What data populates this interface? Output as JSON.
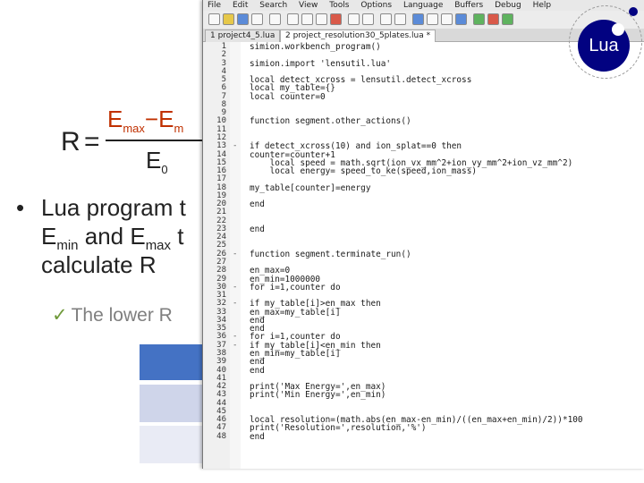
{
  "slide": {
    "formula": {
      "lhs": "R",
      "equals": "=",
      "numerator_a": "E",
      "numerator_a_sub": "max",
      "minus": "−",
      "numerator_b": "E",
      "numerator_b_sub": "m",
      "denominator": "E",
      "denominator_sub": "0"
    },
    "bullet": {
      "dot": "•",
      "line1": "Lua program t",
      "line2_a": "E",
      "line2_a_sub": "min",
      "line2_b": " and E",
      "line2_b_sub": "max",
      "line2_c": " t",
      "line3": "calculate R"
    },
    "check": {
      "mark": "✓",
      "text": "The lower R"
    }
  },
  "editor": {
    "menu": [
      "File",
      "Edit",
      "Search",
      "View",
      "Tools",
      "Options",
      "Language",
      "Buffers",
      "Debug",
      "Help"
    ],
    "tabs": [
      "1 project4_5.lua",
      "2 project_resolution30_5plates.lua *"
    ],
    "lines": [
      {
        "n": "1",
        "fold": "",
        "code": "simion.workbench_program()"
      },
      {
        "n": "2",
        "fold": "",
        "code": ""
      },
      {
        "n": "3",
        "fold": "",
        "code": "simion.import 'lensutil.lua'"
      },
      {
        "n": "4",
        "fold": "",
        "code": ""
      },
      {
        "n": "5",
        "fold": "",
        "code": "local detect_xcross = lensutil.detect_xcross"
      },
      {
        "n": "6",
        "fold": "",
        "code": "local my_table={}"
      },
      {
        "n": "7",
        "fold": "",
        "code": "local counter=0"
      },
      {
        "n": "8",
        "fold": "",
        "code": ""
      },
      {
        "n": "9",
        "fold": "",
        "code": ""
      },
      {
        "n": "10",
        "fold": "",
        "code": "function segment.other_actions()"
      },
      {
        "n": "11",
        "fold": "",
        "code": ""
      },
      {
        "n": "12",
        "fold": "",
        "code": ""
      },
      {
        "n": "13",
        "fold": "-",
        "code": "if detect_xcross(10) and ion_splat==0 then"
      },
      {
        "n": "14",
        "fold": "",
        "code": "counter=counter+1"
      },
      {
        "n": "15",
        "fold": "",
        "code": "    local speed = math.sqrt(ion_vx_mm^2+ion_vy_mm^2+ion_vz_mm^2)"
      },
      {
        "n": "16",
        "fold": "",
        "code": "    local energy= speed_to_ke(speed,ion_mass)"
      },
      {
        "n": "17",
        "fold": "",
        "code": ""
      },
      {
        "n": "18",
        "fold": "",
        "code": "my_table[counter]=energy"
      },
      {
        "n": "19",
        "fold": "",
        "code": ""
      },
      {
        "n": "20",
        "fold": "",
        "code": "end"
      },
      {
        "n": "21",
        "fold": "",
        "code": ""
      },
      {
        "n": "22",
        "fold": "",
        "code": ""
      },
      {
        "n": "23",
        "fold": "",
        "code": "end"
      },
      {
        "n": "24",
        "fold": "",
        "code": ""
      },
      {
        "n": "25",
        "fold": "",
        "code": ""
      },
      {
        "n": "26",
        "fold": "-",
        "code": "function segment.terminate_run()"
      },
      {
        "n": "27",
        "fold": "",
        "code": ""
      },
      {
        "n": "28",
        "fold": "",
        "code": "en_max=0"
      },
      {
        "n": "29",
        "fold": "",
        "code": "en_min=1000000"
      },
      {
        "n": "30",
        "fold": "-",
        "code": "for i=1,counter do"
      },
      {
        "n": "31",
        "fold": "",
        "code": ""
      },
      {
        "n": "32",
        "fold": "-",
        "code": "if my_table[i]>en_max then"
      },
      {
        "n": "33",
        "fold": "",
        "code": "en_max=my_table[i]"
      },
      {
        "n": "34",
        "fold": "",
        "code": "end"
      },
      {
        "n": "35",
        "fold": "",
        "code": "end"
      },
      {
        "n": "36",
        "fold": "-",
        "code": "for i=1,counter do"
      },
      {
        "n": "37",
        "fold": "-",
        "code": "if my_table[i]<en_min then"
      },
      {
        "n": "38",
        "fold": "",
        "code": "en_min=my_table[i]"
      },
      {
        "n": "39",
        "fold": "",
        "code": "end"
      },
      {
        "n": "40",
        "fold": "",
        "code": "end"
      },
      {
        "n": "41",
        "fold": "",
        "code": ""
      },
      {
        "n": "42",
        "fold": "",
        "code": "print('Max Energy=',en_max)"
      },
      {
        "n": "43",
        "fold": "",
        "code": "print('Min Energy=',en_min)"
      },
      {
        "n": "44",
        "fold": "",
        "code": ""
      },
      {
        "n": "45",
        "fold": "",
        "code": ""
      },
      {
        "n": "46",
        "fold": "",
        "code": "local resolution=(math.abs(en_max-en_min)/((en_max+en_min)/2))*100"
      },
      {
        "n": "47",
        "fold": "",
        "code": "print('Resolution=',resolution,'%')"
      },
      {
        "n": "48",
        "fold": "",
        "code": "end"
      }
    ]
  },
  "logo": {
    "text": "Lua"
  },
  "colors": {
    "table_header": "#4472c4",
    "table_row1": "#cfd5ea",
    "table_row2": "#e9ebf5",
    "check_mark": "#6f9a3a",
    "lua_blue": "#020281",
    "keyword": "#0000b0"
  }
}
